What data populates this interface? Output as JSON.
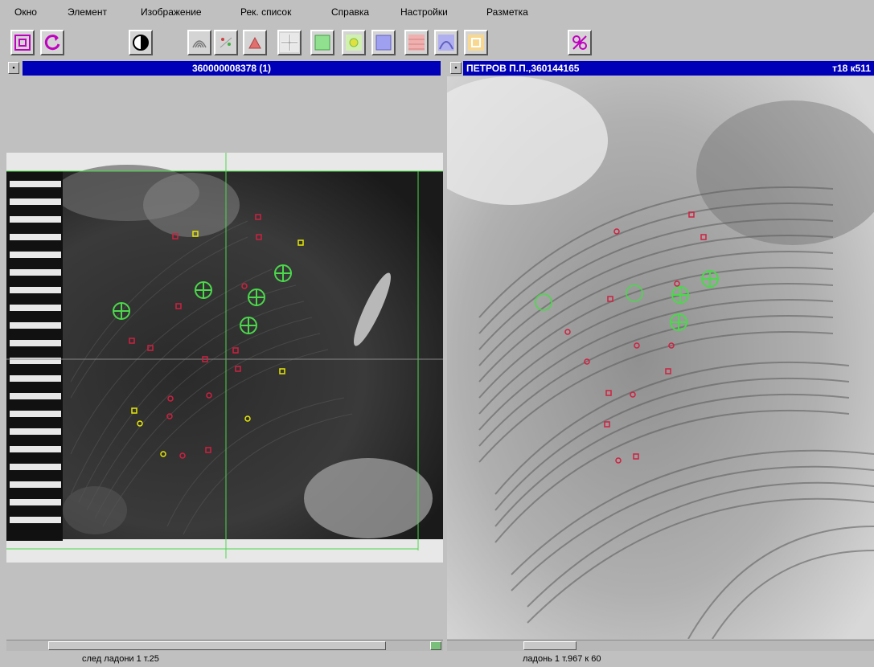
{
  "menu": {
    "items": [
      {
        "label": "Окно"
      },
      {
        "label": "Элемент"
      },
      {
        "label": "Изображение"
      },
      {
        "label": "Рек. список"
      },
      {
        "label": "Справка"
      },
      {
        "label": "Настройки"
      },
      {
        "label": "Разметка"
      }
    ]
  },
  "left_window": {
    "title": "360000008378 (1)",
    "status": "след ладони 1 т.25"
  },
  "right_window": {
    "title": "ПЕТРОВ П.П.,360144165",
    "title_right": "т18 к511",
    "status": "ладонь 1 т.967 к 60"
  },
  "colors": {
    "title_active": "#0000b8",
    "marker_green": "#4bd84b",
    "marker_red": "#d02040",
    "marker_yellow": "#e8e800"
  }
}
